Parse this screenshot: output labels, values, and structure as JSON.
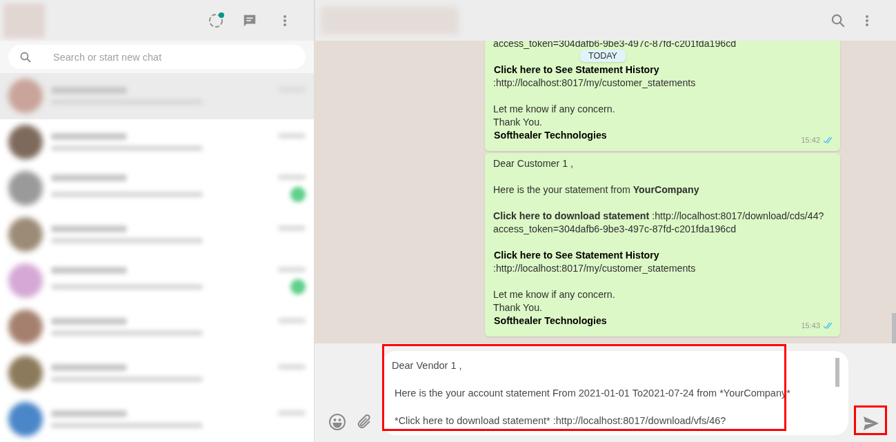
{
  "sidebar": {
    "status_dot": true,
    "search": {
      "placeholder": "Search or start new chat"
    },
    "chats": [
      {
        "color": "#c9a49a",
        "unread": false,
        "selected": true
      },
      {
        "color": "#7e6a5c",
        "unread": false,
        "selected": false
      },
      {
        "color": "#9a9a9a",
        "unread": true,
        "selected": false
      },
      {
        "color": "#9c8c76",
        "unread": false,
        "selected": false
      },
      {
        "color": "#d6a8d6",
        "unread": true,
        "selected": false
      },
      {
        "color": "#a6806e",
        "unread": false,
        "selected": false
      },
      {
        "color": "#8c7a5c",
        "unread": false,
        "selected": false
      },
      {
        "color": "#4a86c8",
        "unread": false,
        "selected": false
      }
    ]
  },
  "date_chip": "TODAY",
  "messages": [
    {
      "blocks": [
        [
          {
            "text": "access_token=304dafb6-9be3-497c-87fd-c201fda196cd"
          }
        ],
        [
          {
            "text": "Click here to See Statement History",
            "bold": true
          },
          {
            "text": ":http://localhost:8017/my/customer_statements"
          }
        ],
        [
          {
            "text": "Let me know if any concern."
          },
          {
            "text": "Thank You."
          },
          {
            "text": "Softhealer Technologies",
            "bold": true
          }
        ]
      ],
      "time": "15:42",
      "read": true
    },
    {
      "blocks": [
        [
          {
            "text": "Dear Customer 1 ,"
          }
        ],
        [
          {
            "text": "Here is the your statement from **YourCompany**"
          }
        ],
        [
          {
            "text": "**Click here to download statement** :http://localhost:8017/download/cds/44?"
          },
          {
            "text": "access_token=304dafb6-9be3-497c-87fd-c201fda196cd"
          }
        ],
        [
          {
            "text": "Click here to See Statement History",
            "bold": true
          },
          {
            "text": ":http://localhost:8017/my/customer_statements"
          }
        ],
        [
          {
            "text": "Let me know if any concern."
          },
          {
            "text": "Thank You."
          },
          {
            "text": "Softhealer Technologies",
            "bold": true
          }
        ]
      ],
      "time": "15:43",
      "read": true
    }
  ],
  "composer": {
    "lines": [
      "Dear Vendor 1 ,",
      "Here is the your account statement From 2021-01-01 To2021-07-24 from *YourCompany*",
      "*Click here to download statement* :http://localhost:8017/download/vfs/46?"
    ],
    "highlighted": true
  }
}
